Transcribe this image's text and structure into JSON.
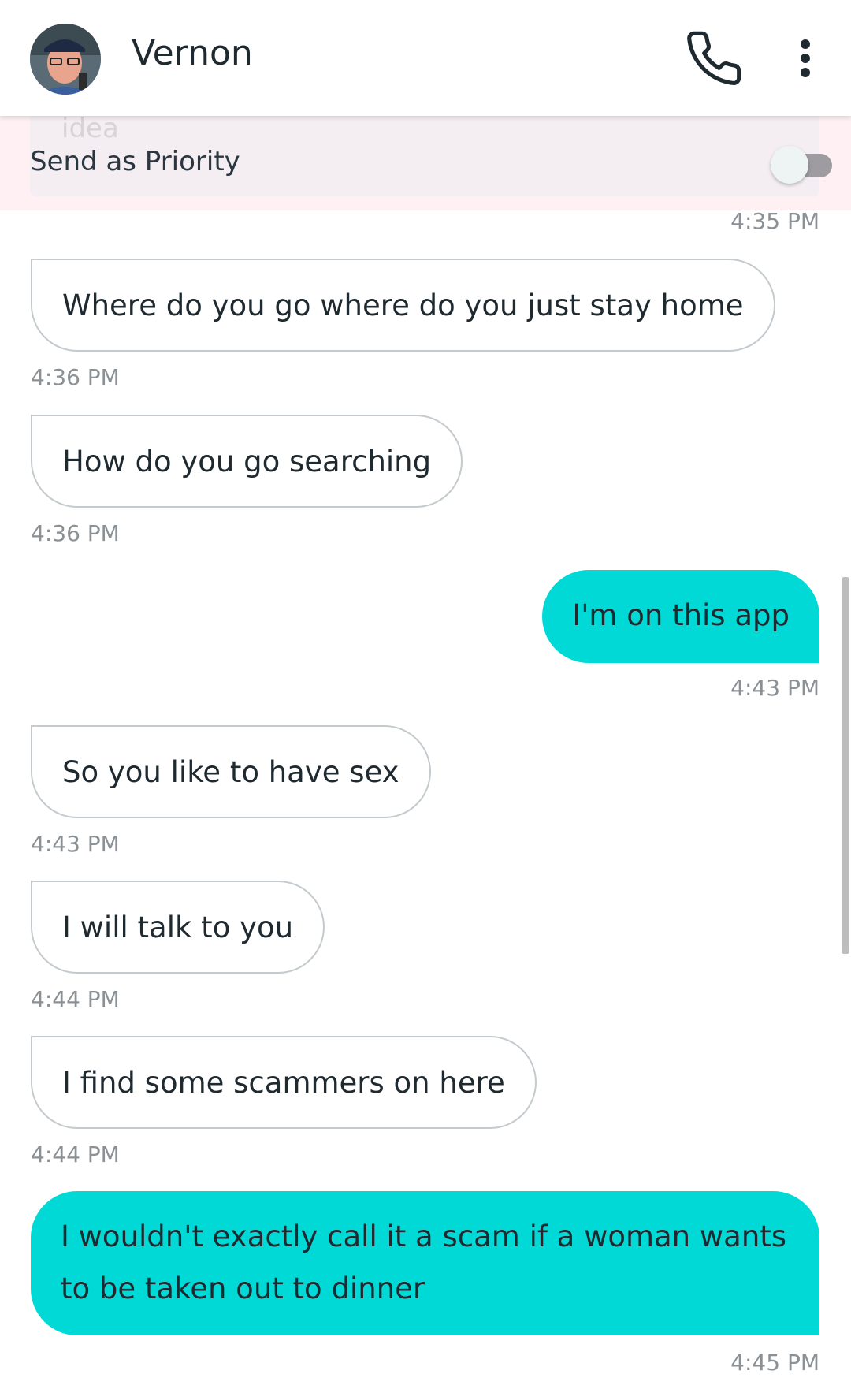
{
  "header": {
    "contact_name": "Vernon",
    "icons": {
      "avatar": "contact-photo",
      "call": "phone-icon",
      "menu": "more-vertical-icon"
    }
  },
  "priority": {
    "label": "Send as Priority",
    "ghost_text": "idea",
    "enabled": false
  },
  "messages": [
    {
      "direction": "outgoing",
      "text": "",
      "time": "4:35 PM"
    },
    {
      "direction": "incoming",
      "text": "Where do you go where do you just stay home",
      "time": "4:36 PM"
    },
    {
      "direction": "incoming",
      "text": "How do you go searching",
      "time": "4:36 PM"
    },
    {
      "direction": "outgoing",
      "text": "I'm on this app",
      "time": "4:43 PM"
    },
    {
      "direction": "incoming",
      "text": "So you like to have sex",
      "time": "4:43 PM"
    },
    {
      "direction": "incoming",
      "text": "I will talk to you",
      "time": "4:44 PM"
    },
    {
      "direction": "incoming",
      "text": "I find some scammers on here",
      "time": "4:44 PM"
    },
    {
      "direction": "outgoing",
      "text": "I wouldn't exactly call it a scam if a woman wants to be taken out to dinner",
      "time": "4:45 PM"
    }
  ],
  "colors": {
    "outgoing_bubble": "#00d9d6",
    "incoming_border": "#c4cacd",
    "priority_background": "#fff0f4",
    "timestamp": "#8a9094"
  }
}
